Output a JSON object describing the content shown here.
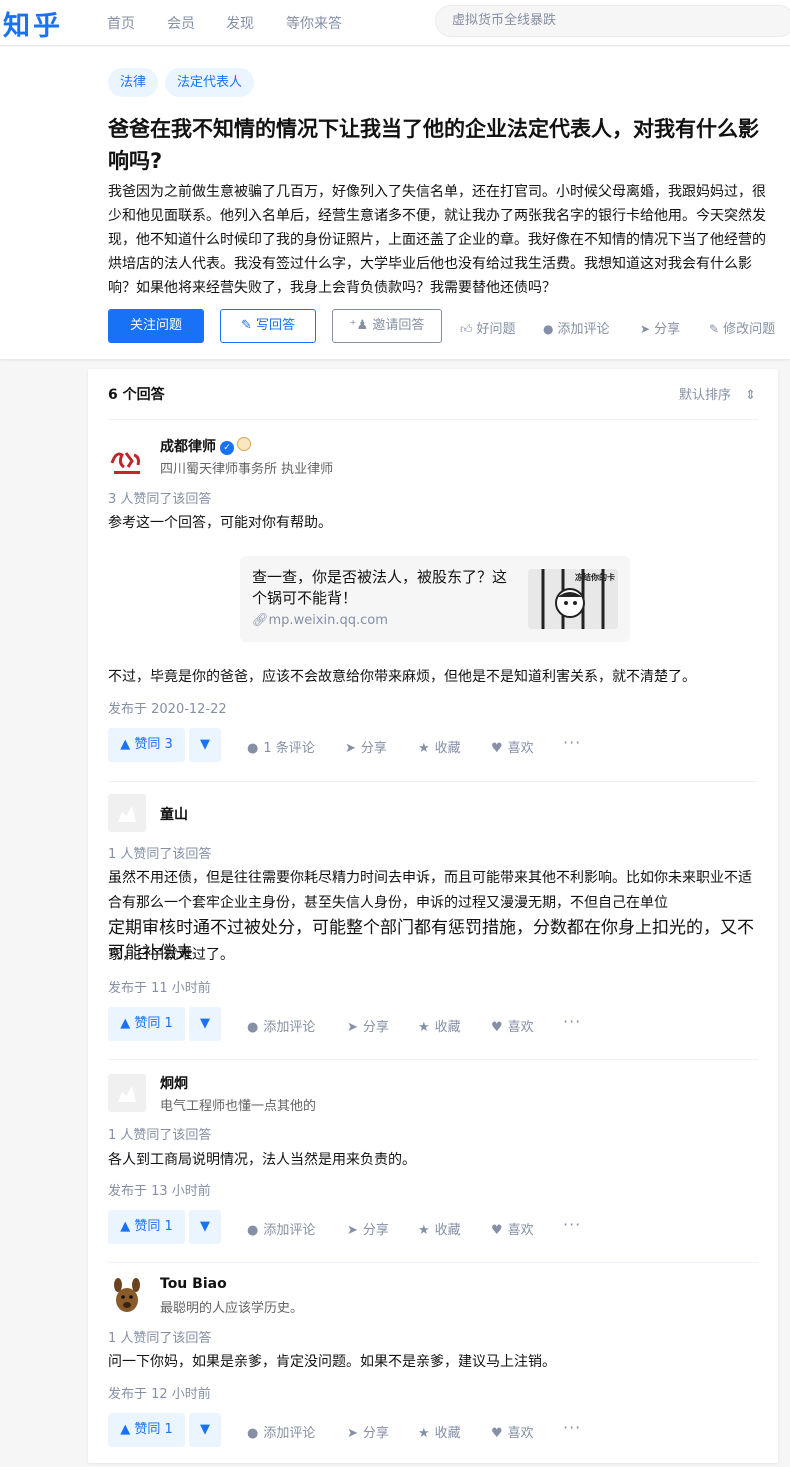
{
  "header": {
    "logo": "知乎",
    "nav": [
      "首页",
      "会员",
      "发现",
      "等你来答"
    ],
    "search_placeholder": "虚拟货币全线暴跌"
  },
  "question": {
    "tags": [
      "法律",
      "法定代表人"
    ],
    "title": "爸爸在我不知情的情况下让我当了他的企业法定代表人，对我有什么影响吗?",
    "detail": "我爸因为之前做生意被骗了几百万，好像列入了失信名单，还在打官司。小时候父母离婚，我跟妈妈过，很少和他见面联系。他列入名单后，经营生意诸多不便，就让我办了两张我名字的银行卡给他用。今天突然发现，他不知道什么时候印了我的身份证照片，上面还盖了企业的章。我好像在不知情的情况下当了他经营的烘培店的法人代表。我没有签过什么字，大学毕业后他也没有给过我生活费。我想知道这对我会有什么影响？如果他将来经营失败了，我身上会背负债款吗？我需要替他还债吗？",
    "buttons": {
      "follow": "关注问题",
      "write": "写回答",
      "invite": "邀请回答"
    },
    "actions": {
      "good": "好问题",
      "comment": "添加评论",
      "share": "分享",
      "edit": "修改问题"
    }
  },
  "answers_header": {
    "count_label": "6 个回答",
    "sort_label": "默认排序"
  },
  "answers": [
    {
      "name": "成都律师",
      "bio": "四川蜀天律师事务所 执业律师",
      "votes_text": "3 人赞同了该回答",
      "text1": "参考这一个回答，可能对你有帮助。",
      "link": {
        "title": "查一查，你是否被法人，被股东了？这个锅可不能背！",
        "url": "mp.weixin.qq.com",
        "thumb_text": "冻结你的卡"
      },
      "text2": "不过，毕竟是你的爸爸，应该不会故意给你带来麻烦，但他是不是知道利害关系，就不清楚了。",
      "date": "发布于 2020-12-22",
      "upvote": "赞同 3",
      "comment": "1 条评论",
      "share": "分享",
      "collect": "收藏",
      "like": "喜欢"
    },
    {
      "name": "童山",
      "bio": "",
      "votes_text": "1 人赞同了该回答",
      "text_small": "虽然不用还债，但是往往需要你耗尽精力时间去申诉，而且可能带来其他不利影响。比如你未来职业不适合有那么一个套牢企业主身份，甚至失信人身份，申诉的过程又漫漫无期，不但自己在单位",
      "text_big": "定期审核时通不过被处分，可能整个部门都有惩罚措施，分数都在你身上扣光的，又不可能补偿夫",
      "text_end": "家，日子就难过了。",
      "date": "发布于 11 小时前",
      "upvote": "赞同 1",
      "comment": "添加评论",
      "share": "分享",
      "collect": "收藏",
      "like": "喜欢"
    },
    {
      "name": "炯炯",
      "bio": "电气工程师也懂一点其他的",
      "votes_text": "1 人赞同了该回答",
      "text": "各人到工商局说明情况，法人当然是用来负责的。",
      "date": "发布于 13 小时前",
      "upvote": "赞同 1",
      "comment": "添加评论",
      "share": "分享",
      "collect": "收藏",
      "like": "喜欢"
    },
    {
      "name": "Tou Biao",
      "bio": "最聪明的人应该学历史。",
      "votes_text": "1 人赞同了该回答",
      "text": "问一下你妈，如果是亲爹，肯定没问题。如果不是亲爹，建议马上注销。",
      "date": "发布于 12 小时前",
      "upvote": "赞同 1",
      "comment": "添加评论",
      "share": "分享",
      "collect": "收藏",
      "like": "喜欢"
    }
  ],
  "colors": {
    "brand": "#1772f6",
    "muted": "#8590a6",
    "vote_bg": "#ebf5ff"
  }
}
